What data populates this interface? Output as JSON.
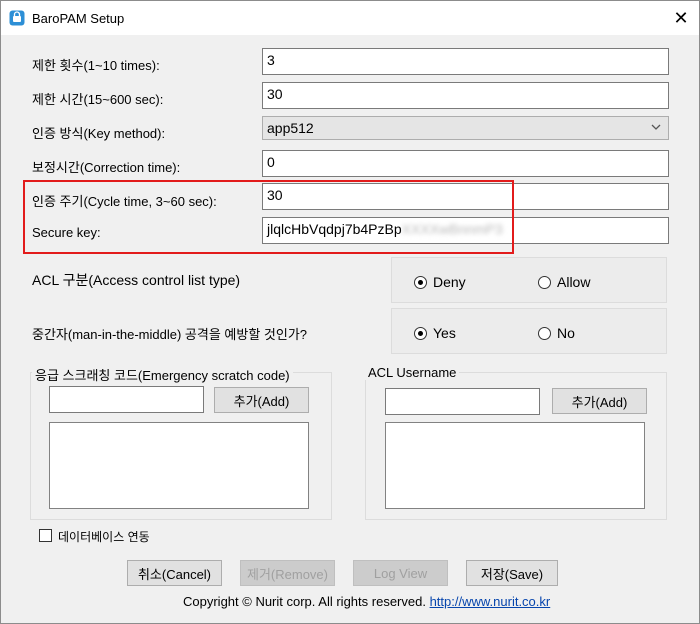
{
  "window": {
    "title": "BaroPAM Setup",
    "close_glyph": "✕"
  },
  "form": {
    "limit_count": {
      "label": "제한 횟수(1~10 times):",
      "value": "3"
    },
    "limit_time": {
      "label": "제한 시간(15~600 sec):",
      "value": "30"
    },
    "key_method": {
      "label": "인증 방식(Key method):",
      "value": "app512"
    },
    "correction_time": {
      "label": "보정시간(Correction time):",
      "value": "0"
    },
    "cycle_time": {
      "label": "인증 주기(Cycle time, 3~60 sec):",
      "value": "30"
    },
    "secure_key": {
      "label": "Secure key:",
      "value": "jlqlcHbVqdpj7b4PzBp",
      "value_hidden": "XXXXwBnnmP3"
    }
  },
  "acl_type": {
    "label": "ACL 구분(Access control list type)",
    "options": [
      "Deny",
      "Allow"
    ],
    "selected": "Deny"
  },
  "mitm": {
    "label": "중간자(man-in-the-middle) 공격을 예방할 것인가?",
    "options": [
      "Yes",
      "No"
    ],
    "selected": "Yes"
  },
  "emergency": {
    "legend": "응급 스크래칭 코드(Emergency scratch code)",
    "add_label": "추가(Add)"
  },
  "acl_username": {
    "legend": "ACL Username",
    "add_label": "추가(Add)"
  },
  "db_link": {
    "label": "데이터베이스 연동",
    "checked": false
  },
  "buttons": {
    "cancel": "취소(Cancel)",
    "remove": "제거(Remove)",
    "log_view": "Log View",
    "save": "저장(Save)"
  },
  "footer": {
    "copyright": "Copyright © Nurit corp. All rights reserved.",
    "url": "http://www.nurit.co.kr"
  },
  "colors": {
    "highlight": "#e21b1b",
    "link": "#0645ad"
  },
  "icons": {
    "app": "key-lock-icon",
    "close": "close-icon",
    "dropdown": "chevron-down-icon"
  }
}
